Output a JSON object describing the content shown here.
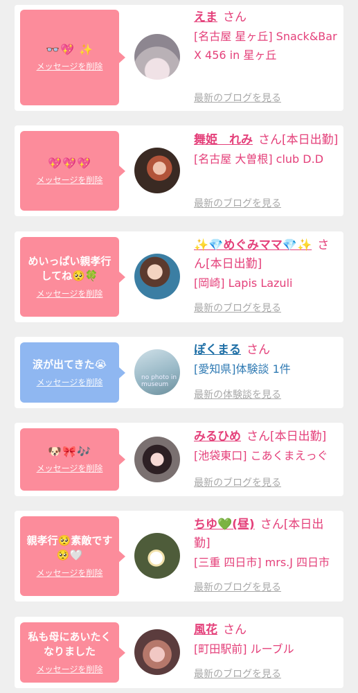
{
  "cards": [
    {
      "message": "",
      "emoji": "👓💖 ✨",
      "delete_label": "メッセージを削除",
      "name": "えま",
      "honorific": "さん",
      "status": "",
      "shop": "[名古屋 星ヶ丘] Snack&Bar X 456 in 星ヶ丘",
      "blog_link": "最新のブログを見る",
      "avatar_label": "",
      "accent": "#fc8c9b"
    },
    {
      "message": "",
      "emoji": "💖💖💖",
      "delete_label": "メッセージを削除",
      "name": "舞姫　れみ",
      "honorific": "さん",
      "status": "[本日出勤]",
      "shop": "[名古屋 大曽根] club D.D",
      "blog_link": "最新のブログを見る",
      "avatar_label": "",
      "accent": "#fc8c9b"
    },
    {
      "message": "めいっぱい親孝行してね🥺🍀",
      "emoji": "",
      "delete_label": "メッセージを削除",
      "name": "✨💎めぐみママ💎✨",
      "honorific": "さん",
      "status": "[本日出勤]",
      "shop": "[岡崎] Lapis Lazuli",
      "blog_link": "最新のブログを見る",
      "avatar_label": "",
      "accent": "#fc8c9b"
    },
    {
      "message": "涙が出てきた😭",
      "emoji": "",
      "delete_label": "メッセージを削除",
      "name": "ぽくまる",
      "honorific": "さん",
      "status": "",
      "shop": "[愛知県]体験談 1件",
      "blog_link": "最新の体験談を見る",
      "avatar_label": "no photo in museum",
      "accent": "#8fb7f1"
    },
    {
      "message": "",
      "emoji": "🐶🎀🎶",
      "delete_label": "メッセージを削除",
      "name": "みるひめ",
      "honorific": "さん",
      "status": "[本日出勤]",
      "shop": "[池袋東口] こあくまえっぐ",
      "blog_link": "最新のブログを見る",
      "avatar_label": "",
      "accent": "#fc8c9b"
    },
    {
      "message": "親孝行🥺素敵です🥺🤍",
      "emoji": "",
      "delete_label": "メッセージを削除",
      "name": "ちゆ💚(昼)",
      "honorific": "さん",
      "status": "[本日出勤]",
      "shop": "[三重 四日市] mrs.J 四日市",
      "blog_link": "最新のブログを見る",
      "avatar_label": "",
      "accent": "#fc8c9b"
    },
    {
      "message": "私も母にあいたくなりました",
      "emoji": "",
      "delete_label": "メッセージを削除",
      "name": "風花",
      "honorific": "さん",
      "status": "",
      "shop": "[町田駅前] ルーブル",
      "blog_link": "最新のブログを見る",
      "avatar_label": "",
      "accent": "#fc8c9b"
    }
  ]
}
